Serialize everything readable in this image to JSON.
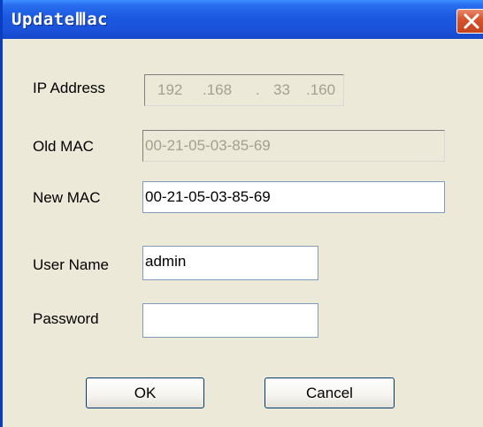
{
  "window": {
    "title": "UpdateⅢac"
  },
  "form": {
    "ip_label": "IP Address",
    "ip_segments": [
      "192",
      ".168",
      ".",
      "33",
      ".160"
    ],
    "old_mac_label": "Old MAC",
    "old_mac_value": "00-21-05-03-85-69",
    "new_mac_label": "New MAC",
    "new_mac_value": "00-21-05-03-85-69",
    "user_label": "User Name",
    "user_value": "admin",
    "password_label": "Password",
    "password_value": ""
  },
  "buttons": {
    "ok": "OK",
    "cancel": "Cancel"
  },
  "icons": {
    "close": "close-icon"
  },
  "colors": {
    "titlebar": "#1b58e0",
    "close_button": "#d5532d",
    "dialog_background": "#ece9d8"
  }
}
